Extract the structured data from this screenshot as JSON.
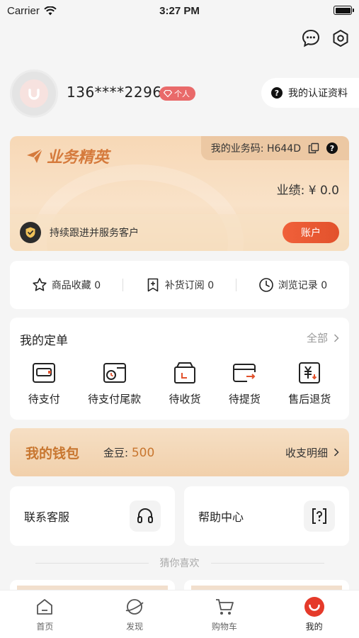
{
  "status_bar": {
    "carrier": "Carrier",
    "time": "3:27 PM"
  },
  "top_icons": [
    "chat-bubble-icon",
    "settings-hexagon-icon"
  ],
  "profile": {
    "phone": "136****2296",
    "badge_label": "个人",
    "certification_label": "我的认证资料"
  },
  "elite_card": {
    "title": "业务精英",
    "business_code_label": "我的业务码: H644D",
    "performance": "业绩: ¥ 0.0",
    "service_text": "持续跟进并服务客户",
    "account_button": "账户"
  },
  "quick_links": [
    {
      "label": "商品收藏 0",
      "icon": "star-outline-icon"
    },
    {
      "label": "补货订阅 0",
      "icon": "bookmark-plus-icon"
    },
    {
      "label": "浏览记录 0",
      "icon": "clock-icon"
    }
  ],
  "orders": {
    "title": "我的定单",
    "all_label": "全部",
    "items": [
      {
        "label": "待支付",
        "icon": "wallet-icon"
      },
      {
        "label": "待支付尾款",
        "icon": "wallet-clock-icon"
      },
      {
        "label": "待收货",
        "icon": "box-icon"
      },
      {
        "label": "待提货",
        "icon": "card-arrow-icon"
      },
      {
        "label": "售后退货",
        "icon": "yen-return-icon"
      }
    ]
  },
  "wallet": {
    "title": "我的钱包",
    "beans_label": "金豆:",
    "beans_value": "500",
    "detail_label": "收支明细"
  },
  "services": [
    {
      "label": "联系客服",
      "icon": "headset-icon"
    },
    {
      "label": "帮助中心",
      "icon": "help-icon"
    }
  ],
  "guess_label": "猜你喜欢",
  "tabbar": [
    {
      "label": "首页",
      "icon": "home-icon"
    },
    {
      "label": "发现",
      "icon": "planet-icon"
    },
    {
      "label": "购物车",
      "icon": "cart-icon"
    },
    {
      "label": "我的",
      "icon": "profile-smile-icon"
    }
  ],
  "colors": {
    "accent": "#e2522c",
    "gold_text": "#c8762f",
    "badge": "#e96a6a"
  }
}
